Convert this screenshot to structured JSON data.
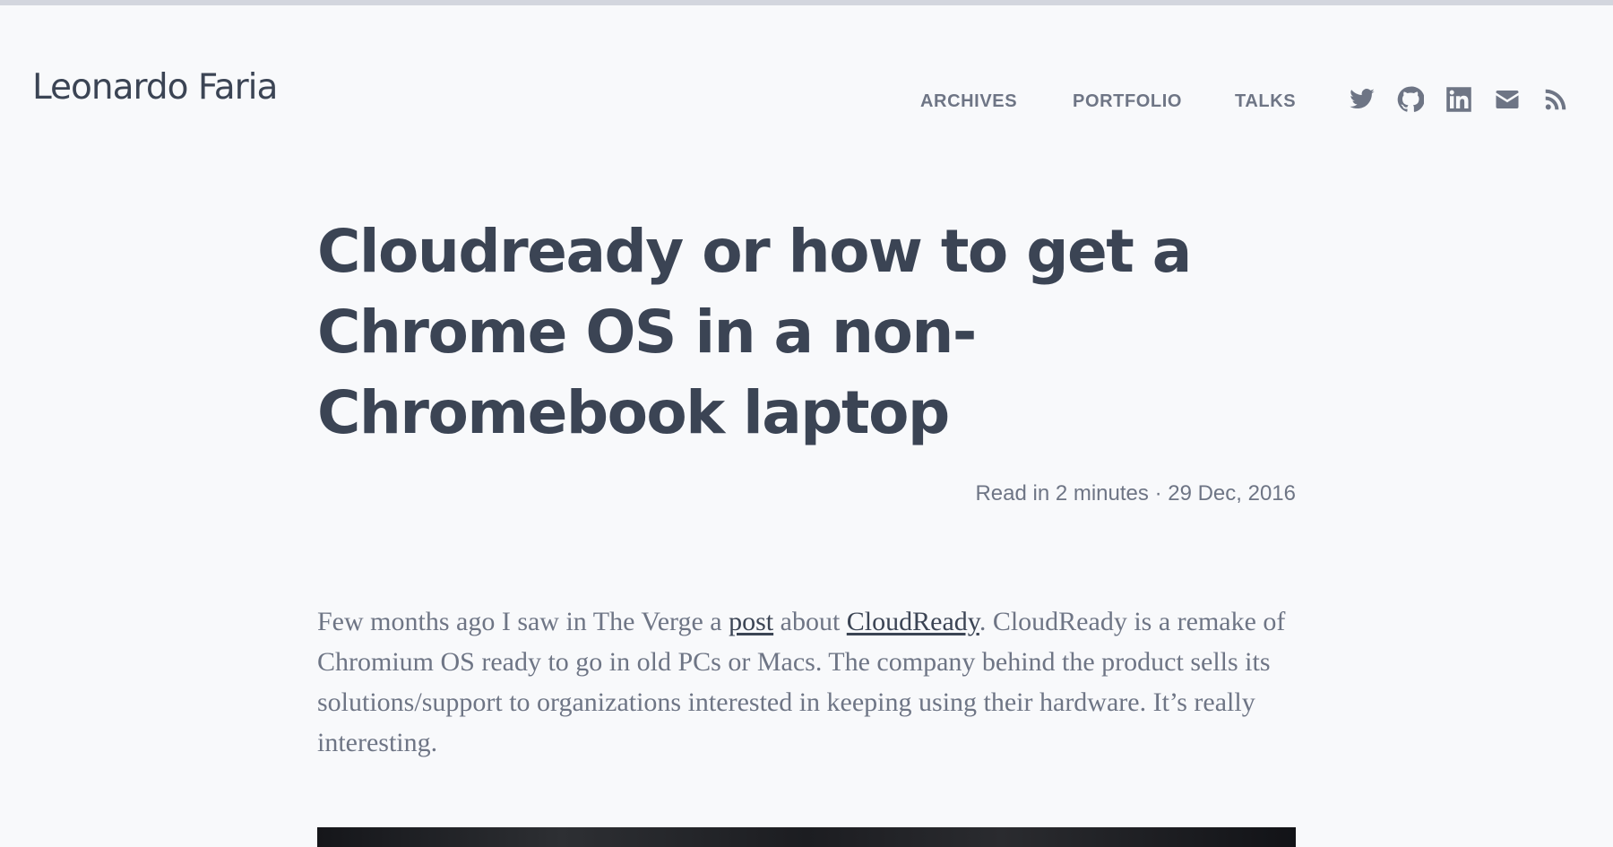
{
  "site": {
    "title": "Leonardo Faria"
  },
  "nav": {
    "items": [
      {
        "label": "ARCHIVES"
      },
      {
        "label": "PORTFOLIO"
      },
      {
        "label": "TALKS"
      }
    ]
  },
  "social": {
    "icons": [
      "twitter-icon",
      "github-icon",
      "linkedin-icon",
      "email-icon",
      "rss-icon"
    ]
  },
  "post": {
    "title": "Cloudready or how to get a Chrome OS in a non-Chromebook laptop",
    "meta": "Read in 2 minutes · 29 Dec, 2016",
    "body": {
      "text_1": "Few months ago I saw in The Verge a ",
      "link_1": "post",
      "text_2": " about ",
      "link_2": "CloudReady",
      "text_3": ". CloudReady is a remake of Chromium OS ready to go in old PCs or Macs. The company behind the product sells its solutions/support to organizations interested in keeping using their hardware. It’s really interesting."
    }
  },
  "colors": {
    "background": "#f8f9fb",
    "text": "#3b4454",
    "muted": "#6e7585",
    "top_bar": "#d3d6de"
  }
}
